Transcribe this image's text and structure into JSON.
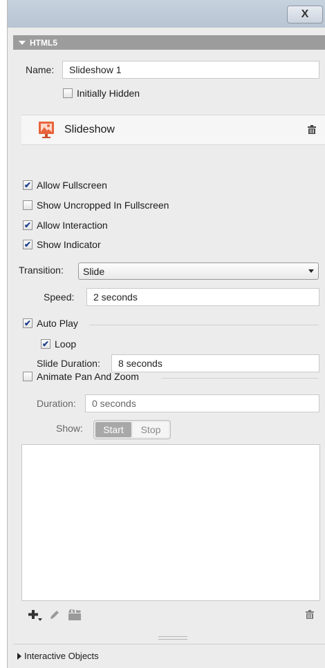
{
  "window": {
    "close_label": "X"
  },
  "section": {
    "title": "HTML5"
  },
  "name_field": {
    "label": "Name:",
    "value": "Slideshow 1"
  },
  "initially_hidden": {
    "label": "Initially Hidden",
    "checked": false
  },
  "widget": {
    "title": "Slideshow",
    "icon": "slideshow-icon",
    "accent_color": "#e8643c"
  },
  "options": [
    {
      "label": "Allow Fullscreen",
      "checked": true
    },
    {
      "label": "Show Uncropped In Fullscreen",
      "checked": false
    },
    {
      "label": "Allow Interaction",
      "checked": true
    },
    {
      "label": "Show Indicator",
      "checked": true
    }
  ],
  "transition": {
    "label": "Transition:",
    "value": "Slide"
  },
  "speed": {
    "label": "Speed:",
    "value": "2 seconds"
  },
  "auto_play": {
    "label": "Auto Play",
    "checked": true
  },
  "loop": {
    "label": "Loop",
    "checked": true
  },
  "slide_duration": {
    "label": "Slide Duration:",
    "value": "8 seconds"
  },
  "animate": {
    "label": "Animate Pan And Zoom",
    "checked": false
  },
  "duration": {
    "label": "Duration:",
    "value": "0 seconds"
  },
  "show": {
    "label": "Show:",
    "options": [
      "Start",
      "Stop"
    ],
    "selected": "Start"
  },
  "toolbar": {
    "icons": [
      "add-icon",
      "edit-icon",
      "clapper-icon",
      "trash-icon"
    ]
  },
  "footer": {
    "label": "Interactive Objects"
  }
}
